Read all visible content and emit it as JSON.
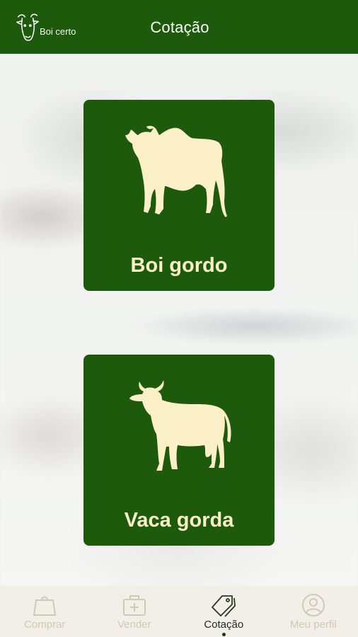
{
  "app": {
    "logo_text": "Boi certo",
    "title": "Cotação"
  },
  "cards": [
    {
      "label": "Boi gordo",
      "icon": "bull-icon"
    },
    {
      "label": "Vaca gorda",
      "icon": "cow-icon"
    }
  ],
  "bottom_nav": {
    "items": [
      {
        "label": "Comprar",
        "icon": "shopping-bag-icon",
        "active": false
      },
      {
        "label": "Vender",
        "icon": "medical-bag-plus-icon",
        "active": false
      },
      {
        "label": "Cotação",
        "icon": "price-tags-icon",
        "active": true
      },
      {
        "label": "Meu perfil",
        "icon": "user-circle-icon",
        "active": false
      }
    ]
  },
  "colors": {
    "brand_green": "#1e5a0c",
    "card_text": "#fbf0c7",
    "nav_inactive": "#cfc9b6",
    "nav_active": "#1f2a1a"
  }
}
